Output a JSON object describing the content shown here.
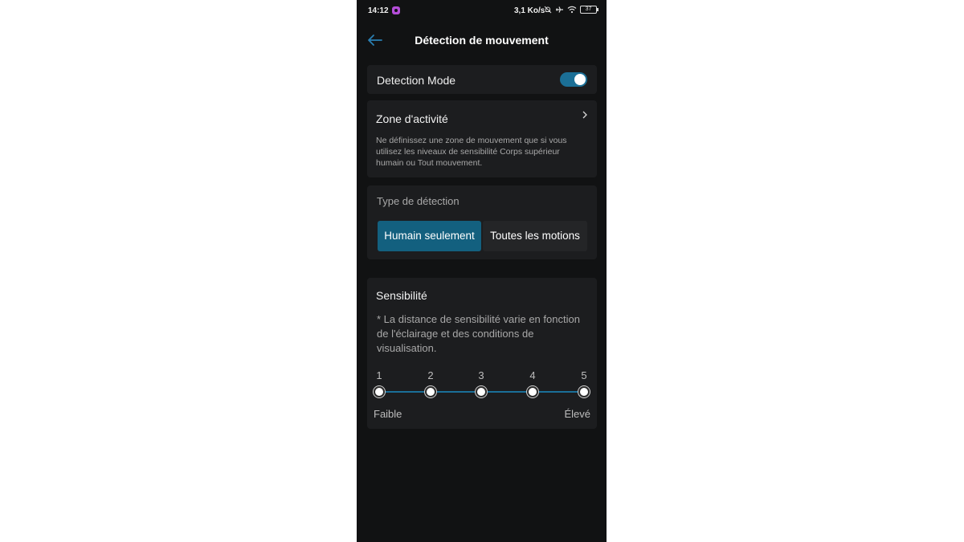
{
  "status_bar": {
    "time": "14:12",
    "speed": "3,1 Ko/s",
    "battery": "37"
  },
  "header": {
    "title": "Détection de mouvement"
  },
  "detection_mode": {
    "label": "Detection Mode",
    "enabled": true
  },
  "activity_zone": {
    "title": "Zone d'activité",
    "description": "Ne définissez une zone de mouvement que si vous utilisez les niveaux de sensibilité Corps supérieur humain ou Tout mouvement."
  },
  "detection_type": {
    "title": "Type de détection",
    "options": [
      "Humain seulement",
      "Toutes les motions"
    ],
    "selected": "Humain seulement"
  },
  "sensitivity": {
    "title": "Sensibilité",
    "note": "* La distance de sensibilité varie en fonction de l'éclairage et des conditions de visualisation.",
    "levels": [
      "1",
      "2",
      "3",
      "4",
      "5"
    ],
    "low_label": "Faible",
    "high_label": "Élevé",
    "current_level": 5
  },
  "colors": {
    "accent": "#13607f",
    "toggle_on": "#1b6f96",
    "background": "#111213",
    "card": "#1c1d1f"
  }
}
